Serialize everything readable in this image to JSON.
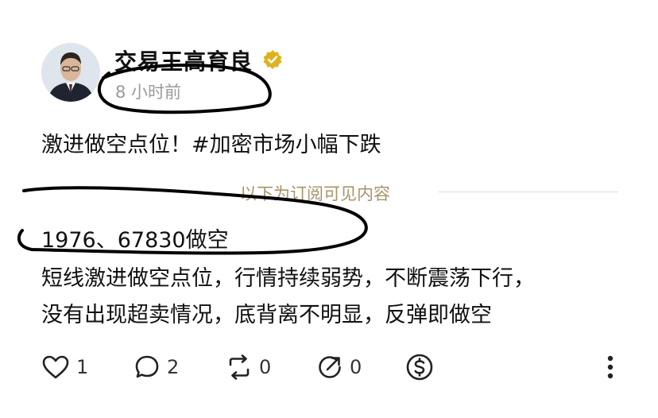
{
  "post": {
    "author": "交易王高育良",
    "time": "8 小时前",
    "text": "激进做空点位！#加密市场小幅下跌",
    "subscription_divider": "以下为订阅可见内容",
    "subscriber_lines": [
      "1976、67830做空",
      "短线激进做空点位，行情持续弱势，不断震荡下行，",
      "没有出现超卖情况，底背离不明显，反弹即做空"
    ]
  },
  "actions": {
    "like_count": "1",
    "comment_count": "2",
    "repost_count": "0",
    "share_count": "0"
  },
  "colors": {
    "verified_badge": "#e0b11f",
    "divider_text": "#a8936a",
    "annotation": "#000000"
  },
  "icons": [
    "heart-icon",
    "comment-icon",
    "repost-icon",
    "share-icon",
    "tip-dollar-icon",
    "more-vertical-icon",
    "verified-badge-icon"
  ]
}
